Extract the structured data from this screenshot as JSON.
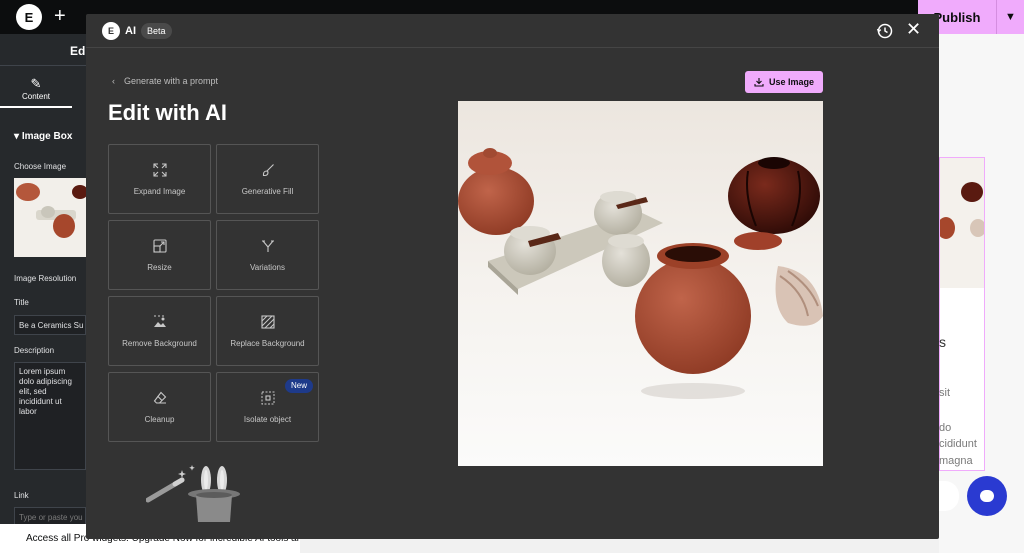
{
  "topbar": {
    "logo_letter": "E",
    "add_icon": "plus-icon",
    "publish_label": "Publish",
    "publish_color": "#f0abfc"
  },
  "left_panel": {
    "header_partial": "Edi",
    "tab_label": "Content",
    "section_title": "Image Box",
    "choose_image_label": "Choose Image",
    "resolution_label": "Image Resolution",
    "title_label": "Title",
    "title_value": "Be a Ceramics Su",
    "description_label": "Description",
    "description_value": "Lorem ipsum dolo adipiscing elit, sed incididunt ut labor",
    "link_label": "Link",
    "link_placeholder": "Type or paste you"
  },
  "promo": {
    "text": "Access all Pro widgets: Upgrade Now for incredible AI tools are"
  },
  "canvas": {
    "fragments": [
      "s",
      "sit",
      "do",
      "cididunt",
      "magna"
    ]
  },
  "modal": {
    "brand": "AI",
    "badge": "Beta",
    "back_label": "Generate with a prompt",
    "title": "Edit with AI",
    "use_image_label": "Use Image",
    "tools": [
      {
        "label": "Expand Image",
        "icon": "expand-icon"
      },
      {
        "label": "Generative Fill",
        "icon": "brush-icon"
      },
      {
        "label": "Resize",
        "icon": "resize-icon"
      },
      {
        "label": "Variations",
        "icon": "variations-icon"
      },
      {
        "label": "Remove Background",
        "icon": "remove-background-icon"
      },
      {
        "label": "Replace Background",
        "icon": "replace-background-icon"
      },
      {
        "label": "Cleanup",
        "icon": "eraser-icon"
      },
      {
        "label": "Isolate object",
        "icon": "isolate-icon",
        "badge": "New"
      }
    ],
    "accent_color": "#f0abfc",
    "new_badge_color": "#1e3a8a"
  }
}
